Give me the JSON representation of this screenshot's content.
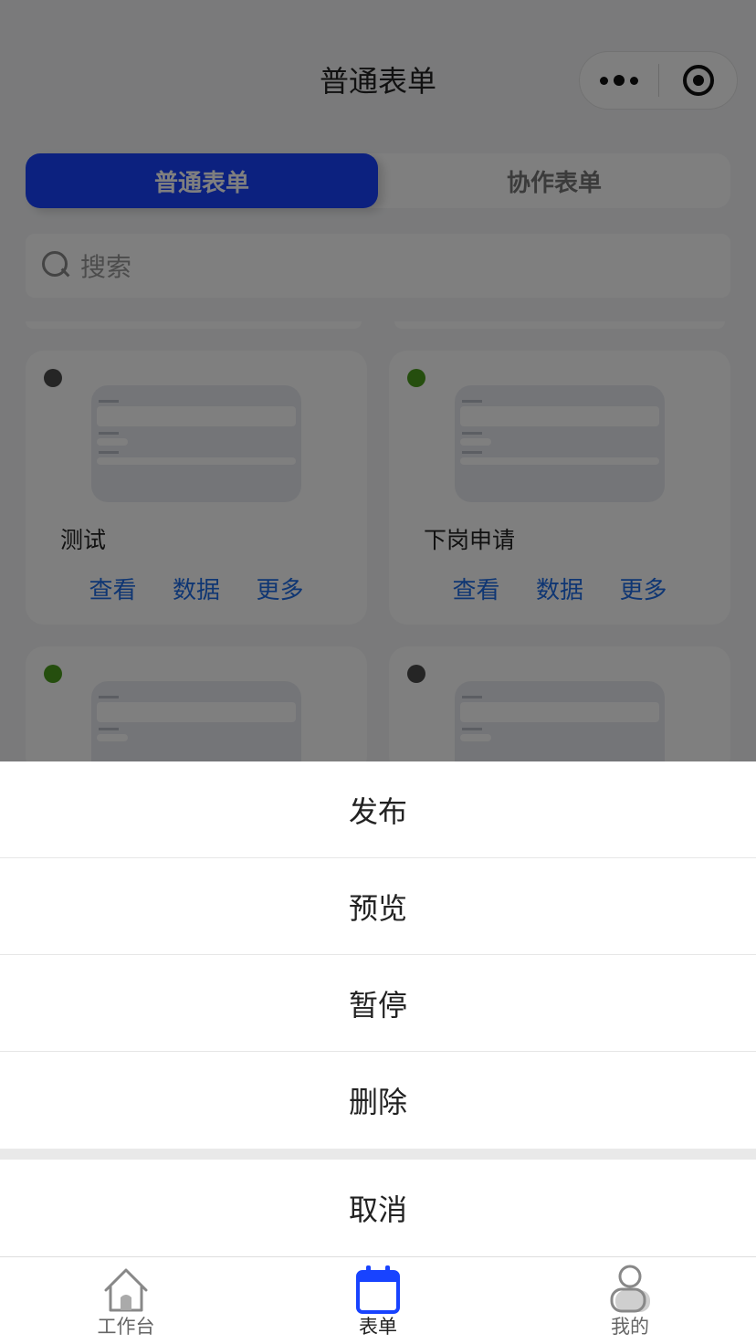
{
  "nav": {
    "title": "普通表单"
  },
  "tabs": [
    {
      "label": "普通表单",
      "active": true
    },
    {
      "label": "协作表单",
      "active": false
    }
  ],
  "search": {
    "placeholder": "搜索"
  },
  "cards": [
    {
      "name": "测试",
      "status_color": "#4a4a4a",
      "actions": [
        "查看",
        "数据",
        "更多"
      ]
    },
    {
      "name": "下岗申请",
      "status_color": "#4a9c1c",
      "actions": [
        "查看",
        "数据",
        "更多"
      ]
    },
    {
      "name": "",
      "status_color": "#4a9c1c",
      "actions": []
    },
    {
      "name": "",
      "status_color": "#4a4a4a",
      "actions": []
    }
  ],
  "action_sheet": {
    "items": [
      "发布",
      "预览",
      "暂停",
      "删除"
    ],
    "cancel": "取消"
  },
  "tabbar": [
    {
      "label": "工作台",
      "icon": "home-icon",
      "active": false
    },
    {
      "label": "表单",
      "icon": "calendar-icon",
      "active": true
    },
    {
      "label": "我的",
      "icon": "user-icon",
      "active": false
    }
  ],
  "colors": {
    "accent": "#1843ff",
    "link": "#1e6de6"
  }
}
